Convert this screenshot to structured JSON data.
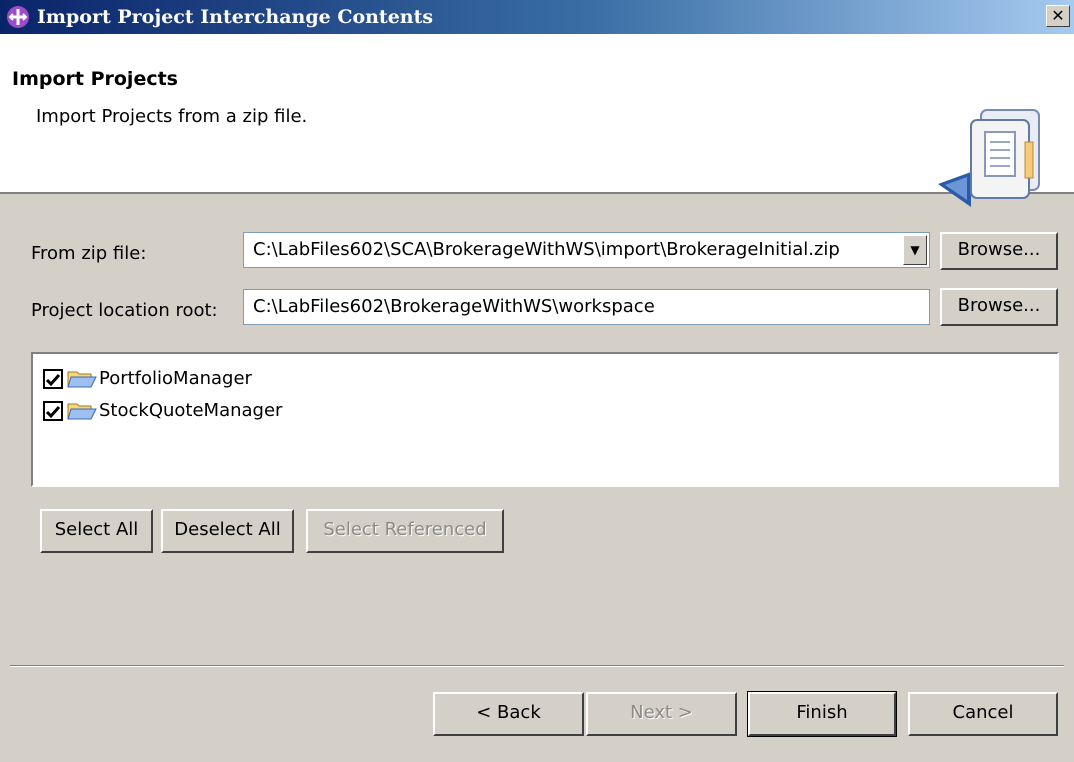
{
  "window": {
    "title": "Import Project Interchange Contents",
    "close_glyph": "✕",
    "icon": "wizard-app-icon"
  },
  "header": {
    "title": "Import Projects",
    "description": "Import Projects from a zip file.",
    "banner_icon": "import-document-icon"
  },
  "form": {
    "zip_label": "From zip file:",
    "zip_value": "C:\\LabFiles602\\SCA\\BrokerageWithWS\\import\\BrokerageInitial.zip",
    "root_label": "Project location root:",
    "root_value": "C:\\LabFiles602\\BrokerageWithWS\\workspace",
    "browse_label": "Browse..."
  },
  "projects": [
    {
      "name": "PortfolioManager",
      "checked": true
    },
    {
      "name": "StockQuoteManager",
      "checked": true
    }
  ],
  "selection_buttons": {
    "select_all": "Select All",
    "deselect_all": "Deselect All",
    "select_referenced": "Select Referenced"
  },
  "footer": {
    "back": "< Back",
    "next": "Next >",
    "finish": "Finish",
    "cancel": "Cancel"
  },
  "colors": {
    "title_gradient_start": "#0a246a",
    "title_gradient_end": "#a6caf0",
    "dialog_face": "#d4d0c8"
  }
}
